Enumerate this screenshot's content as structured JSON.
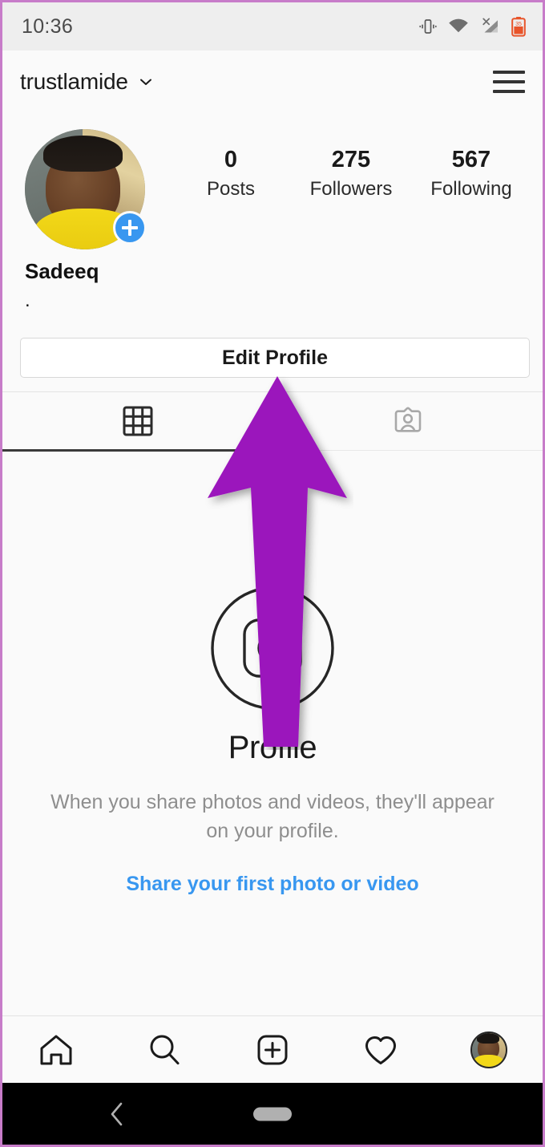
{
  "status_bar": {
    "time": "10:36",
    "icons": [
      "vibrate-icon",
      "wifi-icon",
      "cellular-no-signal-icon",
      "battery-low-icon"
    ],
    "battery_level": "35"
  },
  "app_header": {
    "username": "trustlamide",
    "dropdown_icon": "chevron-down-icon",
    "menu_icon": "hamburger-menu-icon"
  },
  "profile": {
    "avatar_alt": "profile-photo",
    "add_story_icon": "plus-icon",
    "full_name": "Sadeeq",
    "bio": ".",
    "stats": [
      {
        "value": "0",
        "label": "Posts"
      },
      {
        "value": "275",
        "label": "Followers"
      },
      {
        "value": "567",
        "label": "Following"
      }
    ]
  },
  "actions": {
    "edit_profile_label": "Edit Profile"
  },
  "tabs": [
    {
      "name": "grid-tab",
      "icon": "grid-icon",
      "active": true
    },
    {
      "name": "tagged-tab",
      "icon": "tagged-person-icon",
      "active": false
    }
  ],
  "empty_state": {
    "icon": "camera-in-circle-icon",
    "title": "Profile",
    "description": "When you share photos and videos, they'll appear on your profile.",
    "link_label": "Share your first photo or video"
  },
  "bottom_nav": [
    {
      "name": "nav-home",
      "icon": "home-icon"
    },
    {
      "name": "nav-search",
      "icon": "search-icon"
    },
    {
      "name": "nav-create",
      "icon": "plus-square-icon"
    },
    {
      "name": "nav-activity",
      "icon": "heart-icon"
    },
    {
      "name": "nav-profile",
      "icon": "avatar-icon"
    }
  ],
  "android_nav": {
    "back_icon": "back-chevron-icon",
    "home_icon": "home-pill-icon"
  },
  "annotation": {
    "type": "arrow-up",
    "color": "#9B15BC",
    "points_to": "Edit Profile"
  },
  "colors": {
    "accent_blue": "#3897f0",
    "text_primary": "#1a1a1a",
    "text_muted": "#8e8e8e",
    "background": "#fafafa",
    "border": "#c77cc9",
    "annotation_purple": "#9B15BC"
  }
}
